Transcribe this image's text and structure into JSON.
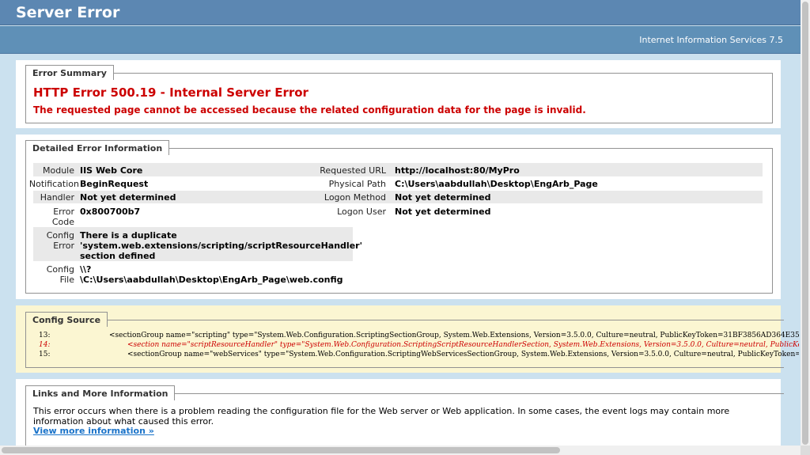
{
  "header": {
    "title": "Server Error",
    "product": "Internet Information Services 7.5"
  },
  "summary": {
    "legend": "Error Summary",
    "heading": "HTTP Error 500.19 - Internal Server Error",
    "message": "The requested page cannot be accessed because the related configuration data for the page is invalid."
  },
  "detail": {
    "legend": "Detailed Error Information",
    "module_label": "Module",
    "module_value": "IIS Web Core",
    "notification_label": "Notification",
    "notification_value": "BeginRequest",
    "handler_label": "Handler",
    "handler_value": "Not yet determined",
    "error_code_label_1": "Error",
    "error_code_label_2": "Code",
    "error_code_value": "0x800700b7",
    "config_error_label_1": "Config",
    "config_error_label_2": "Error",
    "config_error_value_1": "There is a duplicate",
    "config_error_value_2": "'system.web.extensions/scripting/scriptResourceHandler'",
    "config_error_value_3": "section defined",
    "config_file_label_1": "Config",
    "config_file_label_2": "File",
    "config_file_value_1": "\\\\?",
    "config_file_value_2": "\\C:\\Users\\aabdullah\\Desktop\\EngArb_Page\\web.config",
    "requested_url_label": "Requested URL",
    "requested_url_value": "http://localhost:80/MyPro",
    "physical_path_label": "Physical Path",
    "physical_path_value": "C:\\Users\\aabdullah\\Desktop\\EngArb_Page",
    "logon_method_label": "Logon Method",
    "logon_method_value": "Not yet determined",
    "logon_user_label": "Logon User",
    "logon_user_value": "Not yet determined"
  },
  "config_source": {
    "legend": "Config Source",
    "lines": [
      {
        "num": "13:",
        "code": "<sectionGroup name=\"scripting\" type=\"System.Web.Configuration.ScriptingSectionGroup, System.Web.Extensions, Version=3.5.0.0, Culture=neutral, PublicKeyToken=31BF3856AD364E35\">"
      },
      {
        "num": "14:",
        "code": "<section name=\"scriptResourceHandler\" type=\"System.Web.Configuration.ScriptingScriptResourceHandlerSection, System.Web.Extensions, Version=3.5.0.0, Culture=neutral, PublicKeyToken=3"
      },
      {
        "num": "15:",
        "code": "<sectionGroup name=\"webServices\" type=\"System.Web.Configuration.ScriptingWebServicesSectionGroup, System.Web.Extensions, Version=3.5.0.0, Culture=neutral, PublicKeyToken="
      }
    ]
  },
  "links": {
    "legend": "Links and More Information",
    "text": "This error occurs when there is a problem reading the configuration file for the Web server or Web application. In some cases, the event logs may contain more information about what caused this error.",
    "more_link": "View more information »"
  },
  "colors": {
    "header": "#5c87b2",
    "error": "#cc0000",
    "link": "#1a73c9",
    "config_bg": "#fbf6d2"
  }
}
